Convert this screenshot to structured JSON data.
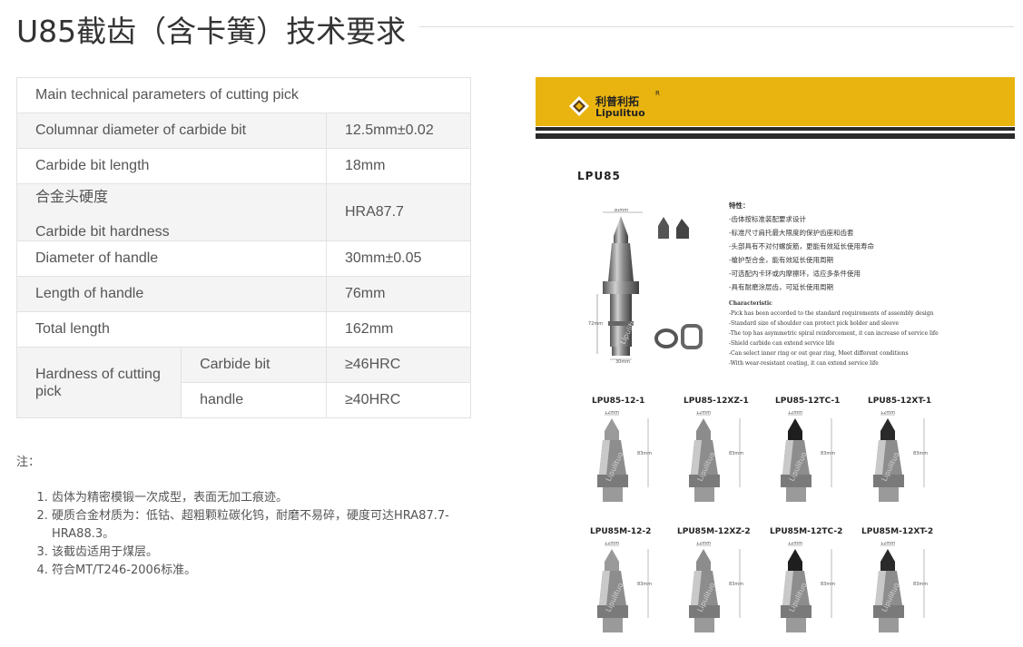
{
  "page": {
    "title": "U85截齿（含卡簧）技术要求"
  },
  "table": {
    "header": "Main technical parameters of cutting pick",
    "rows": [
      {
        "label": "Columnar diameter of carbide bit",
        "value": "12.5mm±0.02"
      },
      {
        "label": "Carbide bit length",
        "value": "18mm"
      },
      {
        "label_cn": "合金头硬度",
        "label": "Carbide bit hardness",
        "value": "HRA87.7"
      },
      {
        "label": "Diameter of handle",
        "value": "30mm±0.05"
      },
      {
        "label": "Length of handle",
        "value": "76mm"
      },
      {
        "label": "Total length",
        "value": "162mm"
      }
    ],
    "hardness": {
      "group_label": "Hardness of cutting pick",
      "rows": [
        {
          "label": "Carbide bit",
          "value": "≥46HRC"
        },
        {
          "label": "handle",
          "value": "≥40HRC"
        }
      ]
    }
  },
  "notes": {
    "heading": "注：",
    "items": [
      "齿体为精密模锻一次成型，表面无加工痕迹。",
      "硬质合金材质为：低钴、超粗颗粒碳化钨，耐磨不易碎，硬度可达HRA87.7-HRA88.3。",
      "该截齿适用于煤层。",
      "符合MT/T246-2006标准。"
    ]
  },
  "product_image": {
    "brand_cn": "利普利拓",
    "brand_en": "Lipulituo",
    "registered": "R",
    "watermark": "Lipulituo",
    "colors": {
      "brand_yellow": "#e9b410",
      "stripe": "#2a2a2a"
    },
    "model": "LPU85",
    "features_cn_title": "特性：",
    "features_cn": [
      "-齿体按标准装配要求设计",
      "-标准尺寸肩托最大限度的保护齿座和齿套",
      "-头部具有不对付螺旋筋，更能有效延长使用寿命",
      "-槍护型合金，能有效延长使用周期",
      "-可选配内卡环或内摩擦环，适应多条件使用",
      "-具有耐磨涂层齿，可延长使用周期"
    ],
    "features_en_title": "Characteristic",
    "features_en": [
      "-Pick has been accorded to the standard requirements of assembly design",
      "-Standard size of shoulder can protect pick holder and sleeve",
      "-The top has asymmetric spiral reinforcement, it can increase of service life",
      "-Shield carbide can extend service life",
      "-Can select inner ring or out gear ring, Meet different conditions",
      "-With wear-resistant coating, it can extend service life"
    ],
    "dims": {
      "top": "30mm",
      "side": "72mm",
      "bottom": "30mm",
      "bit": "12mm",
      "body": "83mm"
    },
    "variants_row1": [
      "LPU85-12-1",
      "LPU85-12XZ-1",
      "LPU85-12TC-1",
      "LPU85-12XT-1"
    ],
    "variants_row2": [
      "LPU85M-12-2",
      "LPU85M-12XZ-2",
      "LPU85M-12TC-2",
      "LPU85M-12XT-2"
    ]
  }
}
